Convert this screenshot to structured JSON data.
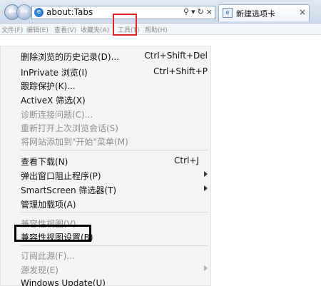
{
  "titlebar": {
    "address": "about:Tabs",
    "tab_label": "新建选项卡"
  },
  "menubar": {
    "file": "文件(F)",
    "edit": "编辑(E)",
    "view": "查看(V)",
    "favorites": "收藏夹(A)",
    "tools": "工具(T)",
    "help": "帮助(H)"
  },
  "menu": {
    "items": [
      {
        "label": "删除浏览的历史记录(D)...",
        "shortcut": "Ctrl+Shift+Del"
      },
      {
        "label": "InPrivate 浏览(I)",
        "shortcut": "Ctrl+Shift+P"
      },
      {
        "label": "跟踪保护(K)..."
      },
      {
        "label": "ActiveX 筛选(X)"
      },
      {
        "label": "诊断连接问题(C)..."
      },
      {
        "label": "重新打开上次浏览会话(S)"
      },
      {
        "label": "将网站添加到\"开始\"菜单(M)"
      },
      {
        "label": "查看下载(N)",
        "shortcut": "Ctrl+J"
      },
      {
        "label": "弹出窗口阻止程序(P)"
      },
      {
        "label": "SmartScreen 筛选器(T)"
      },
      {
        "label": "管理加载项(A)"
      },
      {
        "label": "兼容性视图(V)"
      },
      {
        "label": "兼容性视图设置(B)"
      },
      {
        "label": "订阅此源(F)..."
      },
      {
        "label": "源发现(E)"
      },
      {
        "label": "Windows Update(U)"
      }
    ]
  }
}
